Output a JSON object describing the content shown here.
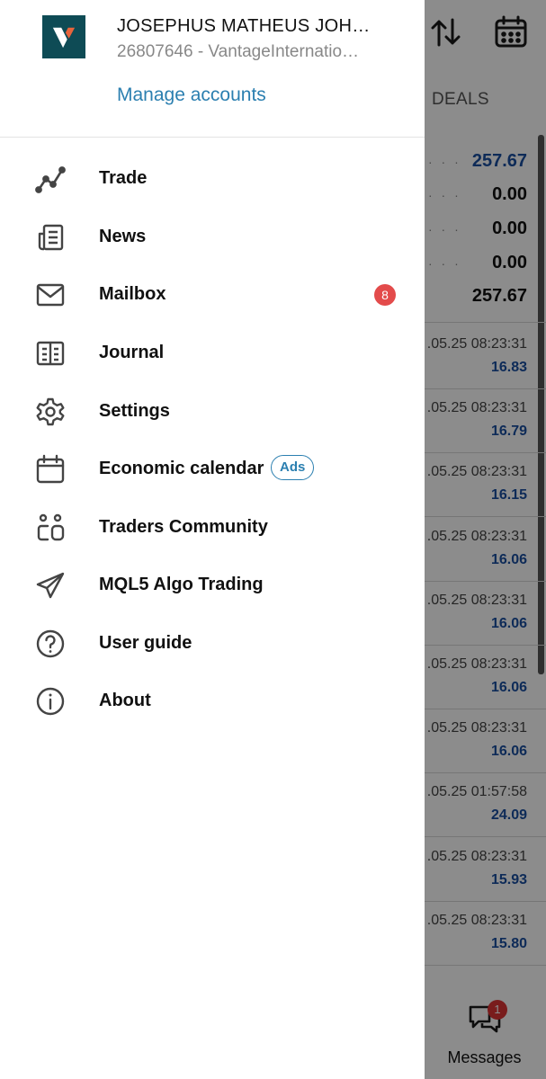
{
  "account": {
    "name": "JOSEPHUS MATHEUS JOH…",
    "number": "26807646 - VantageInternatio…",
    "manage_label": "Manage accounts",
    "logo_letter": "V"
  },
  "menu": [
    {
      "label": "Trade",
      "icon": "trade-chart-icon"
    },
    {
      "label": "News",
      "icon": "news-icon"
    },
    {
      "label": "Mailbox",
      "icon": "mail-icon",
      "badge": "8"
    },
    {
      "label": "Journal",
      "icon": "journal-icon"
    },
    {
      "label": "Settings",
      "icon": "gear-icon"
    },
    {
      "label": "Economic calendar",
      "icon": "calendar-icon",
      "tag": "Ads"
    },
    {
      "label": "Traders Community",
      "icon": "community-icon"
    },
    {
      "label": "MQL5 Algo Trading",
      "icon": "paper-plane-icon"
    },
    {
      "label": "User guide",
      "icon": "help-icon"
    },
    {
      "label": "About",
      "icon": "info-icon"
    }
  ],
  "background": {
    "tab_label": "DEALS",
    "summary_values": [
      "257.67",
      "0.00",
      "0.00",
      "0.00",
      "257.67"
    ],
    "deals": [
      {
        "time": ".05.25 08:23:31",
        "value": "16.83"
      },
      {
        "time": ".05.25 08:23:31",
        "value": "16.79"
      },
      {
        "time": ".05.25 08:23:31",
        "value": "16.15"
      },
      {
        "time": ".05.25 08:23:31",
        "value": "16.06"
      },
      {
        "time": ".05.25 08:23:31",
        "value": "16.06"
      },
      {
        "time": ".05.25 08:23:31",
        "value": "16.06"
      },
      {
        "time": ".05.25 08:23:31",
        "value": "16.06"
      },
      {
        "time": ".05.25 01:57:58",
        "value": "24.09"
      },
      {
        "time": ".05.25 08:23:31",
        "value": "15.93"
      },
      {
        "time": ".05.25 08:23:31",
        "value": "15.80"
      }
    ],
    "messages_label": "Messages",
    "messages_badge": "1"
  },
  "colors": {
    "accent": "#2b7fb0",
    "badge": "#e34b4b",
    "logo_bg": "#0e4b55",
    "logo_mark": "#e8643c",
    "deal_value": "#1a4fa0"
  }
}
